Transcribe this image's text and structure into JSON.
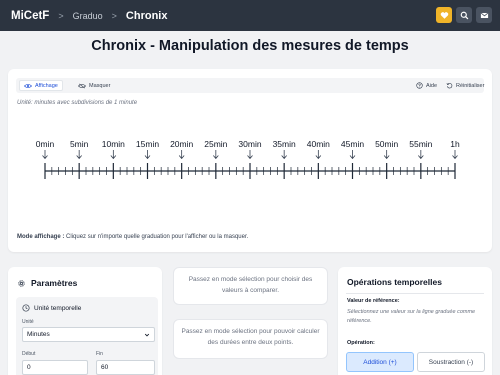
{
  "header": {
    "brand": "MiCetF",
    "breadcrumb": [
      "Graduo",
      "Chronix"
    ],
    "accent_color": "#f0b429",
    "buttons": [
      "heart-icon",
      "search-icon",
      "mail-icon"
    ]
  },
  "page": {
    "title": "Chronix - Manipulation des mesures de temps"
  },
  "ruler": {
    "toolbar": {
      "display_label": "Affichage",
      "hide_label": "Masquer",
      "help_label": "Aide",
      "reset_label": "Réinitialiser"
    },
    "unit_note": "Unité: minutes avec subdivisions de 1 minute",
    "labels": [
      "0min",
      "5min",
      "10min",
      "15min",
      "20min",
      "25min",
      "30min",
      "35min",
      "40min",
      "45min",
      "50min",
      "55min",
      "1h"
    ],
    "start_minute": 0,
    "end_minute": 60,
    "major_step_minutes": 5,
    "subdivision_minutes": 1,
    "mode_note_bold": "Mode affichage :",
    "mode_note": "Cliquez sur n'importe quelle graduation pour l'afficher ou la masquer."
  },
  "params": {
    "title": "Paramètres",
    "unit_section_title": "Unité temporelle",
    "unit_label": "Unité",
    "unit_value": "Minutes",
    "start_label": "Début",
    "start_value": "0",
    "end_label": "Fin",
    "end_value": "60"
  },
  "hints": {
    "compare": "Passez en mode sélection pour choisir des valeurs à comparer.",
    "duration": "Passez en mode sélection pour pouvoir calculer des durées entre deux points."
  },
  "operations": {
    "title": "Opérations temporelles",
    "reference_label": "Valeur de référence:",
    "reference_note": "Sélectionnez une valeur sur la ligne graduée comme référence.",
    "operation_label": "Opération:",
    "add_label": "Addition (+)",
    "subtract_label": "Soustraction (-)"
  }
}
